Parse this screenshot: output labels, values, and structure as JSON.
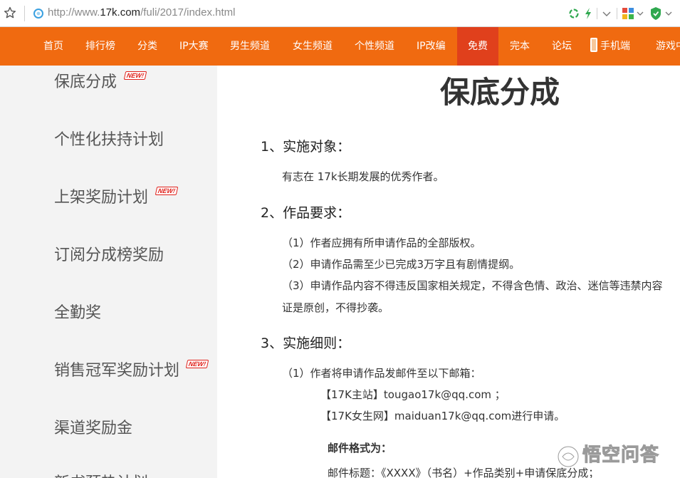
{
  "browser": {
    "url_prefix": "http://www.",
    "url_host": "17k.com",
    "url_path": "/fuli/2017/index.html"
  },
  "nav": {
    "items": [
      "首页",
      "排行榜",
      "分类",
      "IP大赛",
      "男生频道",
      "女生频道",
      "个性频道",
      "IP改编",
      "免费",
      "完本",
      "论坛",
      "手机端",
      "游戏中"
    ],
    "active": "免费",
    "colors": {
      "bar": "#f06a10",
      "active": "#e0401c"
    }
  },
  "sidebar": {
    "items": [
      "保底分成",
      "个性化扶持计划",
      "上架奖励计划",
      "订阅分成榜奖励",
      "全勤奖",
      "销售冠军奖励计划",
      "渠道奖励金",
      "新书预热计划"
    ],
    "badge": "NEW!"
  },
  "article": {
    "title": "保底分成",
    "s1": {
      "heading": "1、实施对象：",
      "text": "有志在 17k长期发展的优秀作者。"
    },
    "s2": {
      "heading": "2、作品要求：",
      "items": [
        "（1）作者应拥有所申请作品的全部版权。",
        "（2）申请作品需至少已完成3万字且有剧情提纲。",
        "（3）申请作品内容不得违反国家相关规定，不得含色情、政治、迷信等违禁内容",
        "证是原创，不得抄袭。"
      ]
    },
    "s3": {
      "heading": "3、实施细则：",
      "items": [
        "（1）作者将申请作品发邮件至以下邮箱：",
        "【17K主站】tougao17k@qq.com ；",
        "【17K女生网】maiduan17k@qq.com进行申请。"
      ],
      "format_label": "邮件格式为：",
      "subject": "邮件标题：《XXXX》（书名）+作品类别+申请保底分成；"
    }
  },
  "watermark": "悟空问答"
}
